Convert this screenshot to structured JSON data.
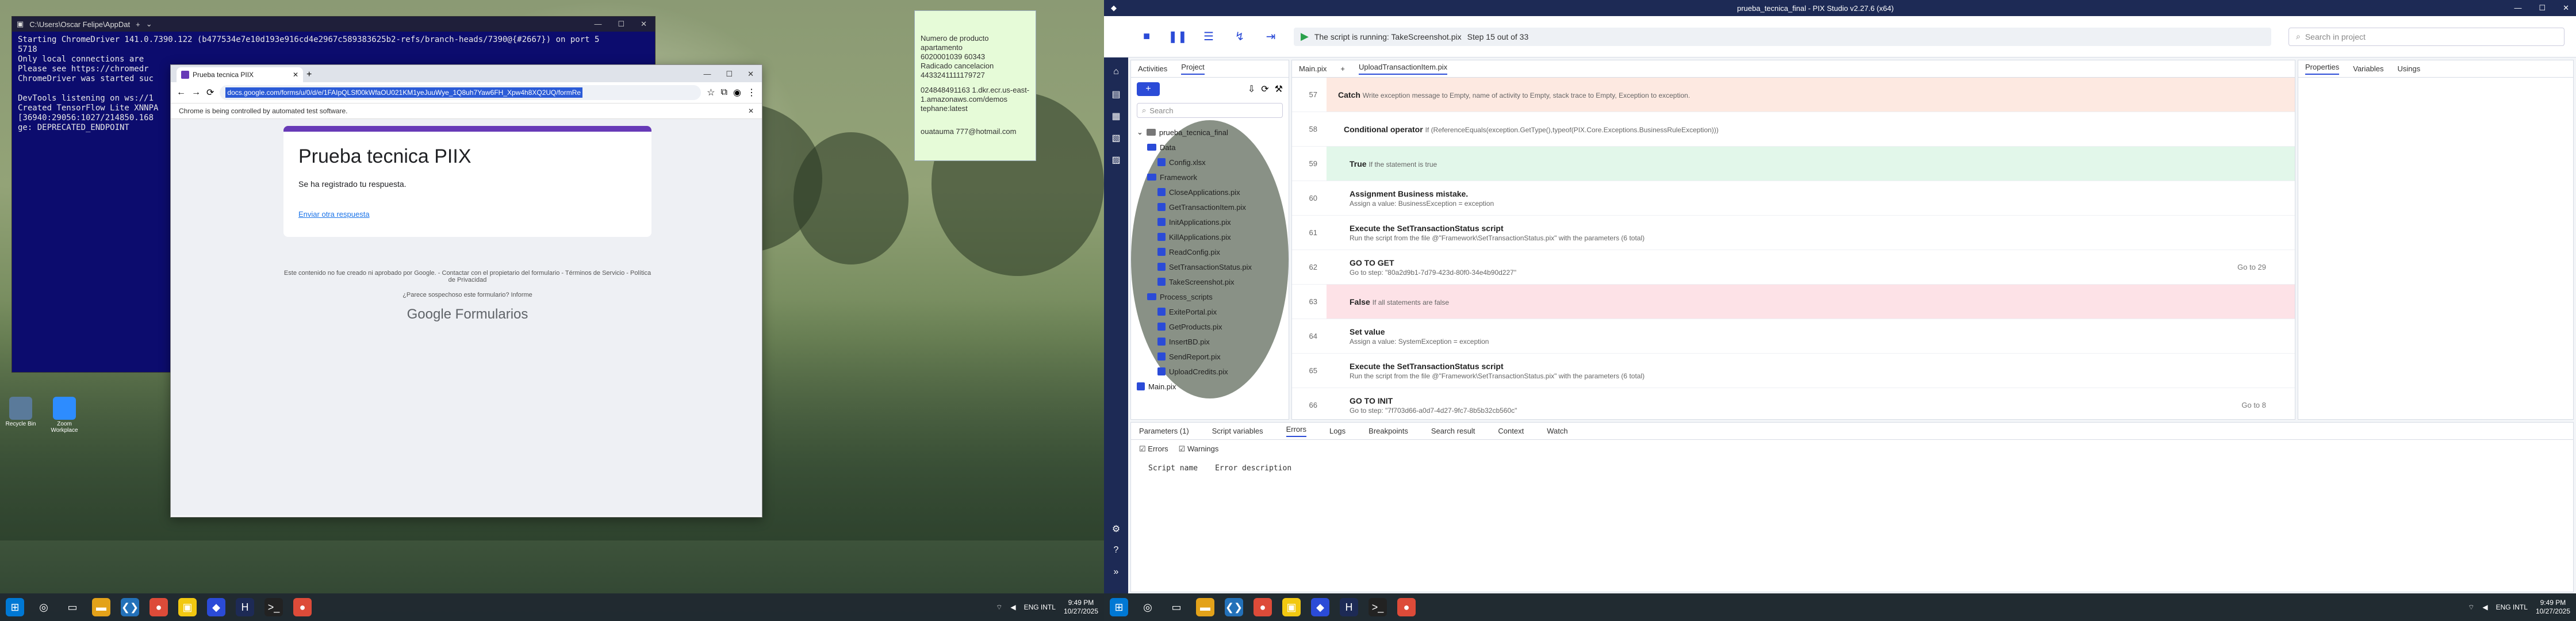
{
  "console": {
    "title": "C:\\Users\\Oscar Felipe\\AppDat",
    "lines": "Starting ChromeDriver 141.0.7390.122 (b477534e7e10d193e916cd4e2967c589383625b2-refs/branch-heads/7390@{#2667}) on port 5\n5718\nOnly local connections are\nPlease see https://chromedr\nChromeDriver was started suc\n\nDevTools listening on ws://1\nCreated TensorFlow Lite XNNPA\n[36940:29056:1027/214850.168\nge: DEPRECATED_ENDPOINT"
  },
  "chrome": {
    "tab_label": "Prueba tecnica PIIX",
    "url": "docs.google.com/forms/u/0/d/e/1FAIpQLSf00kWfaOU021KM1yeJuuWye_1Q8uh7Yaw6FH_Xpw4h8XQ2UQ/formRe",
    "info_bar": "Chrome is being controlled by automated test software.",
    "form_title": "Prueba tecnica PIIX",
    "form_msg": "Se ha registrado tu respuesta.",
    "form_link": "Enviar otra respuesta",
    "footer1": "Este contenido no fue creado ni aprobado por Google. - Contactar con el propietario del formulario - Términos de Servicio - Política de Privacidad",
    "footer2": "¿Parece sospechoso este formulario? Informe",
    "brand": "Google Formularios"
  },
  "notepad": {
    "text1": "Numero de producto apartamento",
    "text2": "6020001039 60343",
    "text3": "Radicado cancelacion",
    "text4": "4433241111179727",
    "text5": "024848491163 1.dkr.ecr.us-east-1.amazonaws.com/demos tephane:latest",
    "text6": "ouatauma 777@hotmail.com"
  },
  "desktop_icons": [
    "Recycle Bin",
    "Zoom Workplace"
  ],
  "taskbar_left": {
    "lang": "ENG INTL",
    "time": "9:49 PM",
    "date": "10/27/2025"
  },
  "pix": {
    "title": "prueba_tecnica_final - PIX Studio v2.27.6 (x64)",
    "status": "The script is running: TakeScreenshot.pix",
    "step": "Step 15 out of 33",
    "search_placeholder": "Search in project",
    "side_tabs": [
      "Activities",
      "Project"
    ],
    "project_search": "Search",
    "project_root": "prueba_tecnica_final",
    "tree": [
      {
        "label": "Data",
        "folder": true,
        "indent": 1
      },
      {
        "label": "Config.xlsx",
        "folder": false,
        "indent": 2
      },
      {
        "label": "Framework",
        "folder": true,
        "indent": 1
      },
      {
        "label": "CloseApplications.pix",
        "folder": false,
        "indent": 2
      },
      {
        "label": "GetTransactionItem.pix",
        "folder": false,
        "indent": 2
      },
      {
        "label": "InitApplications.pix",
        "folder": false,
        "indent": 2
      },
      {
        "label": "KillApplications.pix",
        "folder": false,
        "indent": 2
      },
      {
        "label": "ReadConfig.pix",
        "folder": false,
        "indent": 2
      },
      {
        "label": "SetTransactionStatus.pix",
        "folder": false,
        "indent": 2
      },
      {
        "label": "TakeScreenshot.pix",
        "folder": false,
        "indent": 2
      },
      {
        "label": "Process_scripts",
        "folder": true,
        "indent": 1
      },
      {
        "label": "ExitePortal.pix",
        "folder": false,
        "indent": 2
      },
      {
        "label": "GetProducts.pix",
        "folder": false,
        "indent": 2
      },
      {
        "label": "InsertBD.pix",
        "folder": false,
        "indent": 2
      },
      {
        "label": "SendReport.pix",
        "folder": false,
        "indent": 2
      },
      {
        "label": "UploadCredits.pix",
        "folder": false,
        "indent": 2
      },
      {
        "label": "Main.pix",
        "folder": false,
        "indent": 0
      }
    ],
    "editor_tabs": [
      "Main.pix",
      "UploadTransactionItem.pix"
    ],
    "right_tabs": [
      "Properties",
      "Variables",
      "Usings"
    ],
    "bottom_tabs": [
      "Parameters (1)",
      "Script variables",
      "Errors",
      "Logs",
      "Breakpoints",
      "Search result",
      "Context",
      "Watch"
    ],
    "bottom_errors": "Errors",
    "bottom_warnings": "Warnings",
    "err_col1": "Script name",
    "err_col2": "Error description",
    "lines": [
      {
        "n": "57",
        "kind": "catch",
        "title": "Catch",
        "text": "Write exception message to Empty, name of activity to Empty, stack trace to Empty, Exception to exception."
      },
      {
        "n": "58",
        "kind": "cond",
        "title": "Conditional operator",
        "text": "If (ReferenceEquals(exception.GetType(),typeof(PIX.Core.Exceptions.BusinessRuleException)))"
      },
      {
        "n": "59",
        "kind": "true",
        "title": "True",
        "text": "If the statement is true"
      },
      {
        "n": "60",
        "kind": "act",
        "title": "Assignment Business mistake.",
        "text": "Assign a value: BusinessException = exception"
      },
      {
        "n": "61",
        "kind": "act",
        "title": "Execute the SetTransactionStatus script",
        "text": "Run the script from the file @\"Framework\\SetTransactionStatus.pix\" with the parameters (6 total)"
      },
      {
        "n": "62",
        "kind": "goto",
        "title": "GO TO GET",
        "text": "Go to step: \"80a2d9b1-7d79-423d-80f0-34e4b90d227\"",
        "right": "Go to 29"
      },
      {
        "n": "63",
        "kind": "false",
        "title": "False",
        "text": "If all statements are false"
      },
      {
        "n": "64",
        "kind": "act",
        "title": "Set value",
        "text": "Assign a value: SystemException = exception"
      },
      {
        "n": "65",
        "kind": "act",
        "title": "Execute the SetTransactionStatus script",
        "text": "Run the script from the file @\"Framework\\SetTransactionStatus.pix\" with the parameters (6 total)"
      },
      {
        "n": "66",
        "kind": "goto",
        "title": "GO TO INIT",
        "text": "Go to step: \"7f703d66-a0d7-4d27-9fc7-8b5b32cb560c\"",
        "right": "Go to 8"
      }
    ]
  },
  "taskbar_right": {
    "lang": "ENG INTL",
    "time": "9:49 PM",
    "date": "10/27/2025"
  }
}
